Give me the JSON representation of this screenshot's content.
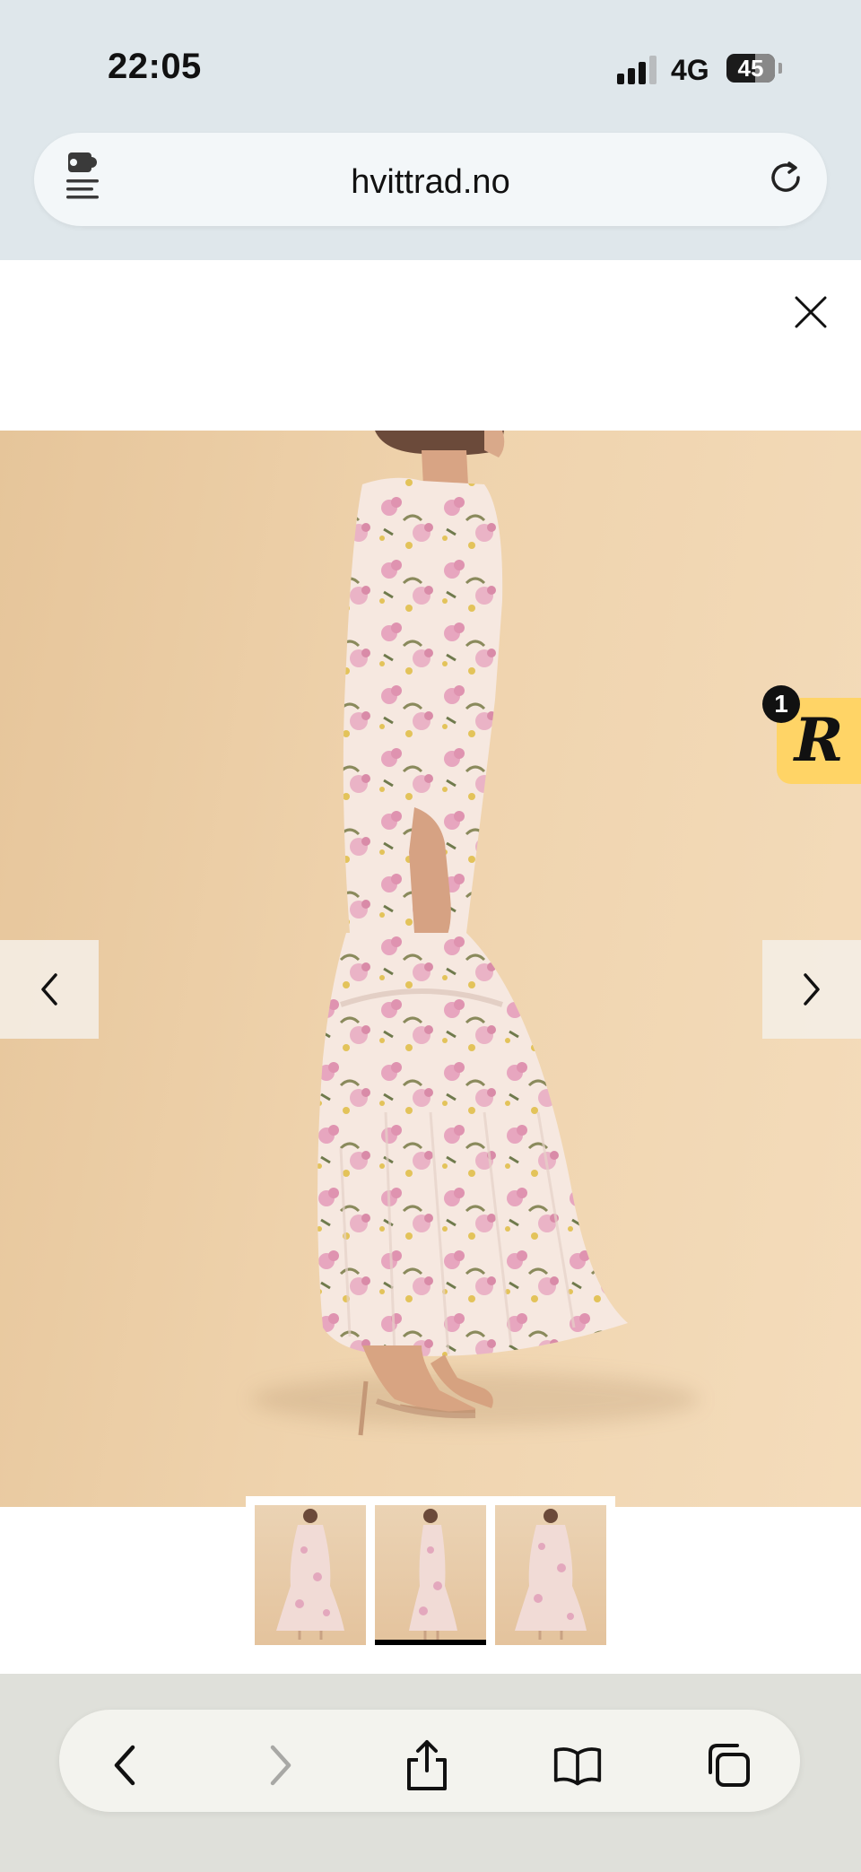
{
  "status_bar": {
    "time": "22:05",
    "network": "4G",
    "battery": "45"
  },
  "browser": {
    "url": "hvittrad.no",
    "extension_icon": "puzzle-menu-icon",
    "reload_icon": "reload-icon"
  },
  "gallery": {
    "close_icon": "close-icon",
    "prev_icon": "chevron-left-icon",
    "next_icon": "chevron-right-icon",
    "thumbnails_count": 3,
    "active_thumbnail": 2
  },
  "badge": {
    "letter": "R",
    "count": "1",
    "color": "#ffd466"
  },
  "toolbar": {
    "back_icon": "chevron-left-icon",
    "forward_icon": "chevron-right-icon",
    "share_icon": "share-icon",
    "bookmarks_icon": "book-icon",
    "tabs_icon": "tabs-icon"
  }
}
